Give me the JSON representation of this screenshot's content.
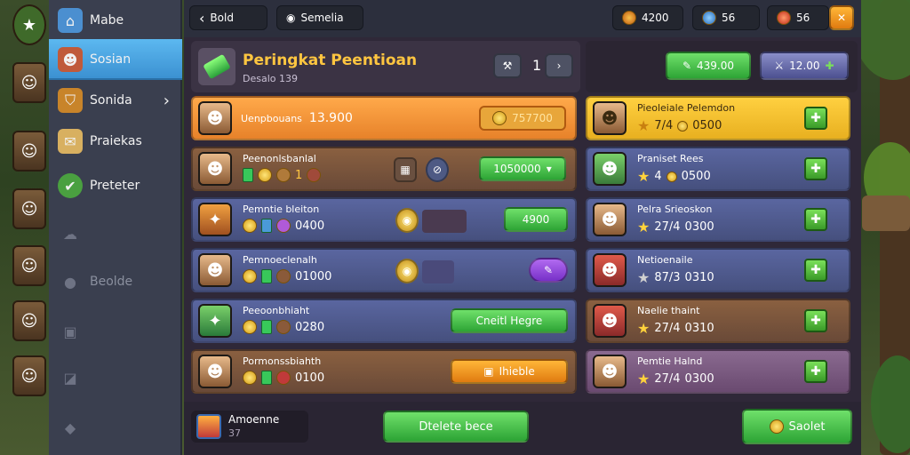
{
  "top": {
    "back_label": "Bold",
    "search_label": "Semelia",
    "res1": "4200",
    "res2": "56",
    "res3": "56"
  },
  "sidebar": {
    "items": [
      {
        "label": "Mabe",
        "icon": "home-icon"
      },
      {
        "label": "Sosian",
        "icon": "character-icon"
      },
      {
        "label": "Sonida",
        "icon": "shield-icon"
      },
      {
        "label": "Praiekas",
        "icon": "scroll-icon"
      },
      {
        "label": "Preteter",
        "icon": "green-shield-icon"
      },
      {
        "label": "",
        "icon": "ghost-icon"
      },
      {
        "label": "Beolde",
        "icon": "person-icon"
      },
      {
        "label": "",
        "icon": "box-icon"
      },
      {
        "label": "",
        "icon": "bag-icon"
      },
      {
        "label": "",
        "icon": "pin-icon"
      }
    ]
  },
  "header": {
    "title": "Peringkat Peentioan",
    "subtitle": "Desalo 139",
    "page": "1",
    "price1": "439.00",
    "price2": "12.00"
  },
  "rows": [
    {
      "title": "Uenpbouans",
      "value": "13.900",
      "btn": "757700"
    },
    {
      "title": "Peenonlsbanlal",
      "value": "",
      "btn": "1050000"
    },
    {
      "title": "Pemntie bleiton",
      "value": "0400",
      "btn": "4900"
    },
    {
      "title": "Pemnoeclenalh",
      "value": "01000",
      "btn": ""
    },
    {
      "title": "Peeoonbhiaht",
      "value": "0280",
      "btn": "Cneitl Hegre"
    },
    {
      "title": "Pormonssbiahth",
      "value": "0100",
      "btn": "Ihieble"
    }
  ],
  "rank": [
    {
      "title": "Pieoleiale Pelemdon",
      "stars": "7/4",
      "value": "0500"
    },
    {
      "title": "Praniset Rees",
      "stars": "4",
      "value": "0500"
    },
    {
      "title": "Pelra Srieoskon",
      "stars": "27/4",
      "value": "0300"
    },
    {
      "title": "Netioenaile",
      "stars": "87/3",
      "value": "0310"
    },
    {
      "title": "Naelie thaint",
      "stars": "27/4",
      "value": "0310"
    },
    {
      "title": "Pemtie Halnd",
      "stars": "27/4",
      "value": "0300"
    }
  ],
  "footer": {
    "left_title": "Amoenne",
    "left_sub": "37",
    "mid_btn": "Dtelete bece",
    "right_btn": "Saolet"
  }
}
